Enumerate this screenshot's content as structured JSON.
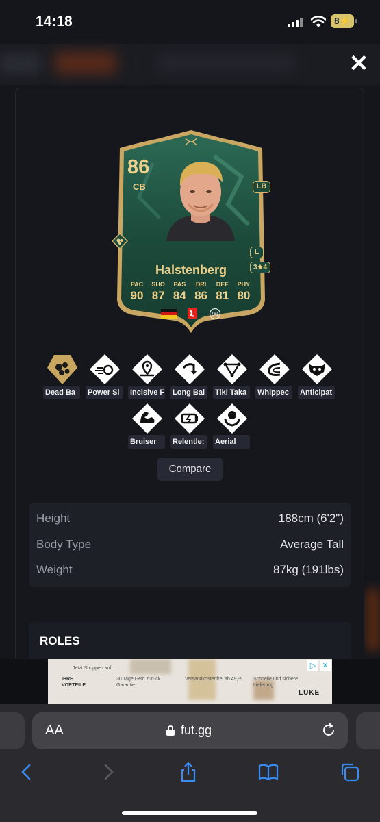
{
  "status": {
    "time": "14:18",
    "battery": "8"
  },
  "modal": {
    "close_label": "✕"
  },
  "card": {
    "rating": "86",
    "position": "CB",
    "alt_position": "LB",
    "foot": "L",
    "skill_weak": "3★4",
    "name": "Halstenberg",
    "stats": [
      {
        "label": "PAC",
        "value": "90"
      },
      {
        "label": "SHO",
        "value": "87"
      },
      {
        "label": "PAS",
        "value": "84"
      },
      {
        "label": "DRI",
        "value": "86"
      },
      {
        "label": "DEF",
        "value": "81"
      },
      {
        "label": "PHY",
        "value": "80"
      }
    ],
    "colors": {
      "card_green": "#1f4f3e",
      "gold": "#ecd08a"
    }
  },
  "playstyles": [
    {
      "label": "Dead Ba",
      "icon": "dead-ball-icon",
      "plus": true
    },
    {
      "label": "Power Sl",
      "icon": "power-shot-icon"
    },
    {
      "label": "Incisive F",
      "icon": "incisive-pass-icon"
    },
    {
      "label": "Long Bal",
      "icon": "long-ball-pass-icon"
    },
    {
      "label": "Tiki Taka",
      "icon": "tiki-taka-icon"
    },
    {
      "label": "Whippec",
      "icon": "whipped-pass-icon"
    },
    {
      "label": "Anticipat",
      "icon": "anticipate-icon"
    },
    {
      "label": "Bruiser",
      "icon": "bruiser-icon"
    },
    {
      "label": "Relentle:",
      "icon": "relentless-icon"
    },
    {
      "label": "Aerial",
      "icon": "aerial-icon"
    }
  ],
  "compare_label": "Compare",
  "info": [
    {
      "label": "Height",
      "value": "188cm (6'2\")"
    },
    {
      "label": "Body Type",
      "value": "Average Tall"
    },
    {
      "label": "Weight",
      "value": "87kg (191lbs)"
    }
  ],
  "roles_title": "ROLES",
  "ad": {
    "line1": "Jetzt Shoppen auf:",
    "col1": "IHRE VORTEILE",
    "col2": "30 Tage Geld zurück Garantie",
    "col3": "Versandkostenfrei ab 49,-€",
    "col4": "Schnelle und sichere Lieferung",
    "brand": "LUKE"
  },
  "safari": {
    "aa_label": "AA",
    "url": "fut.gg"
  }
}
